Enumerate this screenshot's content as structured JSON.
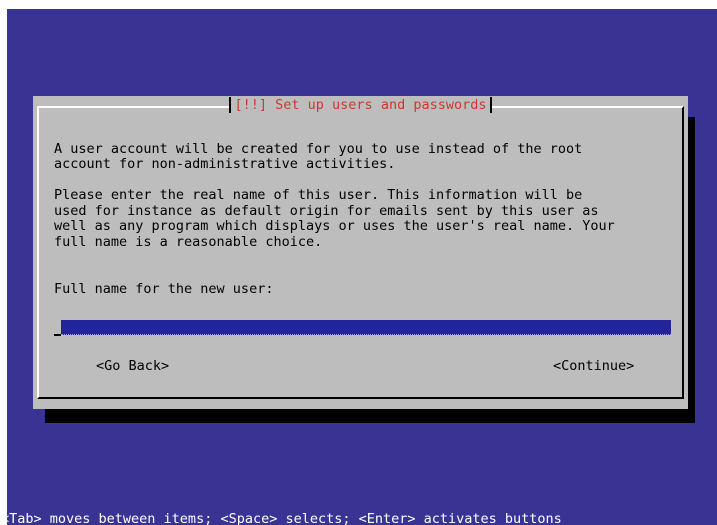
{
  "dialog": {
    "title": "[!!] Set up users and passwords",
    "paragraph1_line1": "A user account will be created for you to use instead of the root",
    "paragraph1_line2": "account for non-administrative activities.",
    "paragraph2_line1": "Please enter the real name of this user. This information will be",
    "paragraph2_line2": "used for instance as default origin for emails sent by this user as",
    "paragraph2_line3": "well as any program which displays or uses the user's real name. Your",
    "paragraph2_line4": "full name is a reasonable choice.",
    "field_label": "Full name for the new user:",
    "field_value": "",
    "back_button": "<Go Back>",
    "continue_button": "<Continue>"
  },
  "footer": {
    "hint": "<Tab> moves between items; <Space> selects; <Enter> activates buttons"
  },
  "colors": {
    "background": "#393493",
    "dialog": "#bdbdbd",
    "title": "#c93a2c",
    "input": "#24249a"
  }
}
